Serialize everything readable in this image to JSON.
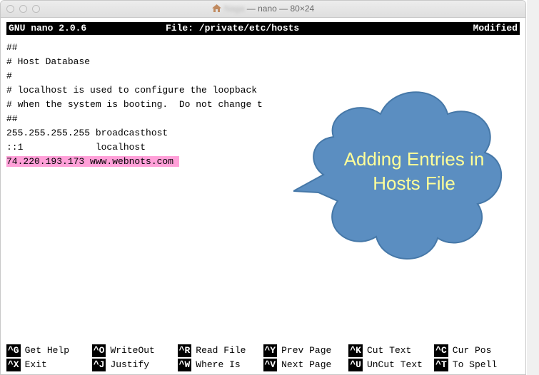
{
  "window": {
    "title_user": "Naga",
    "title_rest": " — nano — 80×24"
  },
  "nano": {
    "app": "GNU nano 2.0.6",
    "file_label": "File: /private/etc/hosts",
    "status": "Modified"
  },
  "editor_lines": {
    "l0": "##",
    "l1": "# Host Database",
    "l2": "#",
    "l3": "# localhost is used to configure the loopback ",
    "l4": "# when the system is booting.  Do not change t",
    "l5": "##",
    "l6": "255.255.255.255 broadcasthost",
    "l7": "::1             localhost",
    "l8": "74.220.193.173 www.webnots.com "
  },
  "callout": {
    "text": "Adding Entries in Hosts File",
    "fill": "#5b8ec1",
    "stroke": "#4678a8",
    "text_color": "#ffff99"
  },
  "shortcuts": {
    "r1c1": {
      "key": "^G",
      "label": "Get Help"
    },
    "r1c2": {
      "key": "^O",
      "label": "WriteOut"
    },
    "r1c3": {
      "key": "^R",
      "label": "Read File"
    },
    "r1c4": {
      "key": "^Y",
      "label": "Prev Page"
    },
    "r1c5": {
      "key": "^K",
      "label": "Cut Text"
    },
    "r1c6": {
      "key": "^C",
      "label": "Cur Pos"
    },
    "r2c1": {
      "key": "^X",
      "label": "Exit"
    },
    "r2c2": {
      "key": "^J",
      "label": "Justify"
    },
    "r2c3": {
      "key": "^W",
      "label": "Where Is"
    },
    "r2c4": {
      "key": "^V",
      "label": "Next Page"
    },
    "r2c5": {
      "key": "^U",
      "label": "UnCut Text"
    },
    "r2c6": {
      "key": "^T",
      "label": "To Spell"
    }
  }
}
